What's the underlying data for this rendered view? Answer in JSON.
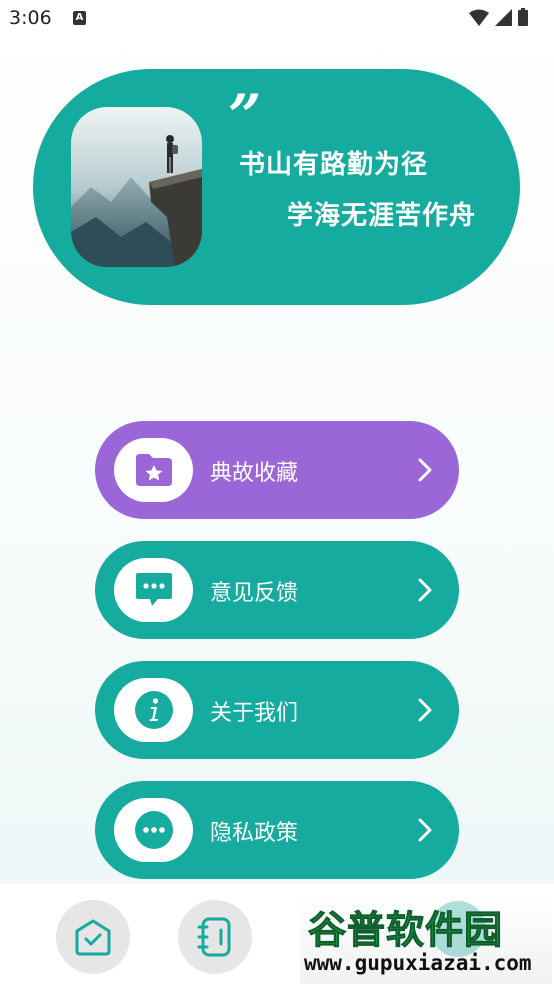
{
  "status_bar": {
    "time": "3:06",
    "notification_icon": "A"
  },
  "hero": {
    "image": "mountain-cliff-hiker-image",
    "quote_mark": "”",
    "line1": "书山有路勤为径",
    "line2": "学海无涯苦作舟",
    "background_color": "#15ab9f"
  },
  "menu": [
    {
      "label": "典故收藏",
      "icon": "folder-star-icon",
      "color": "#9b66d8"
    },
    {
      "label": "意见反馈",
      "icon": "chat-bubble-icon",
      "color": "#15ab9f"
    },
    {
      "label": "关于我们",
      "icon": "info-icon",
      "color": "#15ab9f"
    },
    {
      "label": "隐私政策",
      "icon": "more-dots-icon",
      "color": "#15ab9f"
    }
  ],
  "bottom_nav": {
    "items": [
      {
        "icon": "home-check-icon"
      },
      {
        "icon": "notebook-icon"
      }
    ]
  },
  "watermark": {
    "title": "谷普软件园",
    "url": "www.gupuxiazai.com"
  }
}
